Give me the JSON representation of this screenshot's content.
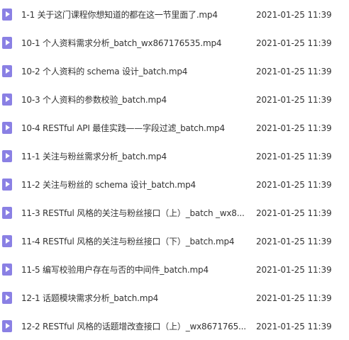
{
  "files": [
    {
      "name": "1-1 关于这门课程你想知道的都在这一节里面了.mp4",
      "date": "2021-01-25 11:39",
      "icon": "video-file-icon"
    },
    {
      "name": "10-1 个人资料需求分析_batch_wx867176535.mp4",
      "date": "2021-01-25 11:39",
      "icon": "video-file-icon"
    },
    {
      "name": "10-2 个人资料的 schema 设计_batch.mp4",
      "date": "2021-01-25 11:39",
      "icon": "video-file-icon"
    },
    {
      "name": "10-3 个人资料的参数校验_batch.mp4",
      "date": "2021-01-25 11:39",
      "icon": "video-file-icon"
    },
    {
      "name": "10-4 RESTful API 最佳实践——字段过滤_batch.mp4",
      "date": "2021-01-25 11:39",
      "icon": "video-file-icon"
    },
    {
      "name": "11-1 关注与粉丝需求分析_batch.mp4",
      "date": "2021-01-25 11:39",
      "icon": "video-file-icon"
    },
    {
      "name": "11-2 关注与粉丝的 schema 设计_batch.mp4",
      "date": "2021-01-25 11:39",
      "icon": "video-file-icon"
    },
    {
      "name": "11-3 RESTful 风格的关注与粉丝接口（上）_batch _wx8...",
      "date": "2021-01-25 11:39",
      "icon": "video-file-icon"
    },
    {
      "name": "11-4 RESTful 风格的关注与粉丝接口（下）_batch.mp4",
      "date": "2021-01-25 11:39",
      "icon": "video-file-icon"
    },
    {
      "name": "11-5 编写校验用户存在与否的中间件_batch.mp4",
      "date": "2021-01-25 11:39",
      "icon": "video-file-icon"
    },
    {
      "name": "12-1 话题模块需求分析_batch.mp4",
      "date": "2021-01-25 11:39",
      "icon": "video-file-icon"
    },
    {
      "name": "12-2 RESTful 风格的话题增改查接口（上）_wx8671765...",
      "date": "2021-01-25 11:39",
      "icon": "video-file-icon"
    }
  ],
  "colors": {
    "icon": "#8a80e4",
    "text": "#333333",
    "background": "#ffffff"
  }
}
